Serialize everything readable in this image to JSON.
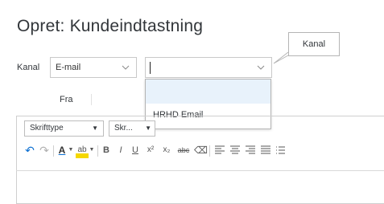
{
  "page": {
    "title": "Opret: Kundeindtastning"
  },
  "kanal": {
    "label": "Kanal",
    "selected": "E-mail",
    "tooltip": "Kanal",
    "second_value": "",
    "dropdown_items": [
      "",
      "HRHD Email"
    ]
  },
  "fra": {
    "label": "Fra"
  },
  "toolbar": {
    "font_select": "Skrifttype",
    "size_select": "Skr...",
    "glyphs": {
      "undo": "↶",
      "redo": "↷",
      "font_color": "A",
      "highlight": "ab",
      "bold": "B",
      "italic": "I",
      "underline": "U",
      "superscript": "x²",
      "subscript": "x₂",
      "strike": "abc",
      "clear_format": "⌫"
    }
  },
  "colors": {
    "accent": "#0a6ed1",
    "dropdown_highlight": "#e8f2fb"
  }
}
